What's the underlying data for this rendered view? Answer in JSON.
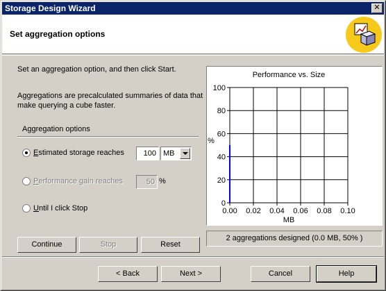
{
  "window": {
    "title": "Storage Design Wizard",
    "close_glyph": "✕"
  },
  "header": {
    "title": "Set aggregation options",
    "icon": "cube-wizard-icon"
  },
  "intro": "Set an aggregation option, and then click Start.",
  "description": "Aggregations are precalculated summaries of data that make querying a cube faster.",
  "aggregation_options": {
    "group_label": "Aggregation options",
    "options": [
      {
        "label_pre": "",
        "label_accel": "E",
        "label_post": "stimated storage reaches",
        "selected": true,
        "enabled": true
      },
      {
        "label_pre": "",
        "label_accel": "P",
        "label_post": "erformance gain reaches",
        "selected": false,
        "enabled": false
      },
      {
        "label_pre": "",
        "label_accel": "U",
        "label_post": "ntil I click Stop",
        "selected": false,
        "enabled": true
      }
    ],
    "storage_value": "100",
    "storage_unit": "MB",
    "performance_value": "50",
    "performance_unit": "%"
  },
  "action_buttons": {
    "continue": "Continue",
    "stop": "Stop",
    "reset": "Reset"
  },
  "chart_data": {
    "type": "line",
    "title": "Performance vs. Size",
    "xlabel": "MB",
    "ylabel": "%",
    "xlim": [
      0,
      0.1
    ],
    "ylim": [
      0,
      100
    ],
    "x_ticks": [
      "0.00",
      "0.02",
      "0.04",
      "0.06",
      "0.08",
      "0.10"
    ],
    "y_ticks": [
      "0",
      "20",
      "40",
      "60",
      "80",
      "100"
    ],
    "grid": true,
    "series": [
      {
        "color": "#0000ff",
        "x": [
          0,
          0
        ],
        "y": [
          0,
          50
        ]
      }
    ]
  },
  "status": "2 aggregations designed (0.0 MB, 50% )",
  "nav_buttons": {
    "back": "< Back",
    "next": "Next >",
    "cancel": "Cancel",
    "help": "Help"
  },
  "colors": {
    "titlebar": "#0a246a",
    "face": "#d4d0c8",
    "accent_icon": "#f7c91a",
    "series": "#0000ff"
  }
}
